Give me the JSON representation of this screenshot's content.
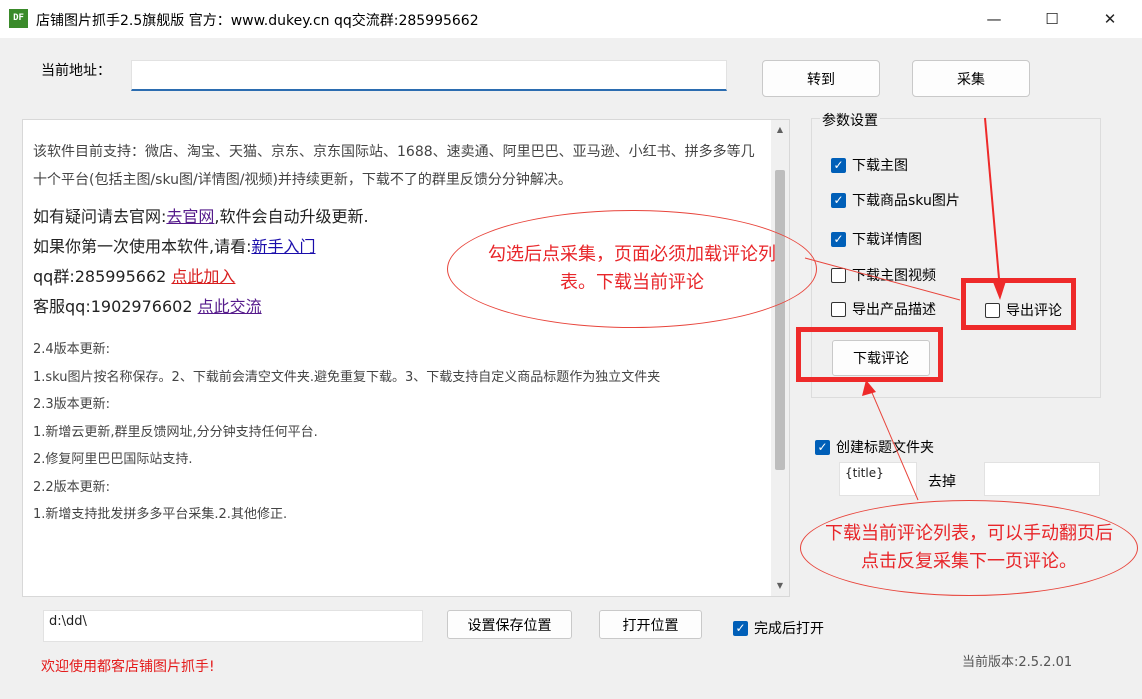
{
  "window": {
    "icon_text": "DF",
    "title": "店铺图片抓手2.5旗舰版 官方：www.dukey.cn qq交流群:285995662",
    "minimize": "—",
    "maximize": "☐",
    "close": "✕"
  },
  "address": {
    "label": "当前地址：",
    "value": "",
    "goto_label": "转到",
    "collect_label": "采集"
  },
  "info": {
    "intro": "该软件目前支持：微店、淘宝、天猫、京东、京东国际站、1688、速卖通、阿里巴巴、亚马逊、小红书、拼多多等几十个平台(包括主图/sku图/详情图/视频)并持续更新，下载不了的群里反馈分分钟解决。",
    "line1_prefix": "如有疑问请去官网:",
    "line1_link": "去官网",
    "line1_suffix": ",软件会自动升级更新.",
    "line2_prefix": "如果你第一次使用本软件,请看:",
    "line2_link": "新手入门",
    "line3_prefix": "qq群:285995662 ",
    "line3_link": "点此加入",
    "line4_prefix": "客服qq:1902976602 ",
    "line4_link": "点此交流",
    "notes": [
      "2.4版本更新:",
      "1.sku图片按名称保存。2、下载前会清空文件夹.避免重复下载。3、下载支持自定义商品标题作为独立文件夹",
      "2.3版本更新:",
      "1.新增云更新,群里反馈网址,分分钟支持任何平台.",
      "2.修复阿里巴巴国际站支持.",
      "2.2版本更新:",
      "1.新增支持批发拼多多平台采集.2.其他修正."
    ]
  },
  "params": {
    "title": "参数设置",
    "download_main": {
      "label": "下载主图",
      "checked": true
    },
    "download_sku": {
      "label": "下载商品sku图片",
      "checked": true
    },
    "download_detail": {
      "label": "下载详情图",
      "checked": true
    },
    "download_video": {
      "label": "下载主图视频",
      "checked": false
    },
    "export_desc": {
      "label": "导出产品描述",
      "checked": false
    },
    "export_reviews": {
      "label": "导出评论",
      "checked": false
    },
    "download_reviews_button": "下载评论"
  },
  "folder": {
    "create_label": "创建标题文件夹",
    "create_checked": true,
    "template_value": "{title}",
    "remove_label": "去掉",
    "remove_value": ""
  },
  "bottom": {
    "path_value": "d:\\dd\\",
    "set_location_label": "设置保存位置",
    "open_location_label": "打开位置",
    "open_after_label": "完成后打开",
    "open_after_checked": true,
    "status": "欢迎使用都客店铺图片抓手!",
    "version": "当前版本:2.5.2.01"
  },
  "annotations": {
    "callout1": "勾选后点采集，页面必须加载评论列表。下载当前评论",
    "callout2": "下载当前评论列表，可以手动翻页后点击反复采集下一页评论。"
  },
  "colors": {
    "accent": "#005fb8",
    "annotation_red": "#ee2a2a",
    "status_red": "#e41b1b"
  }
}
